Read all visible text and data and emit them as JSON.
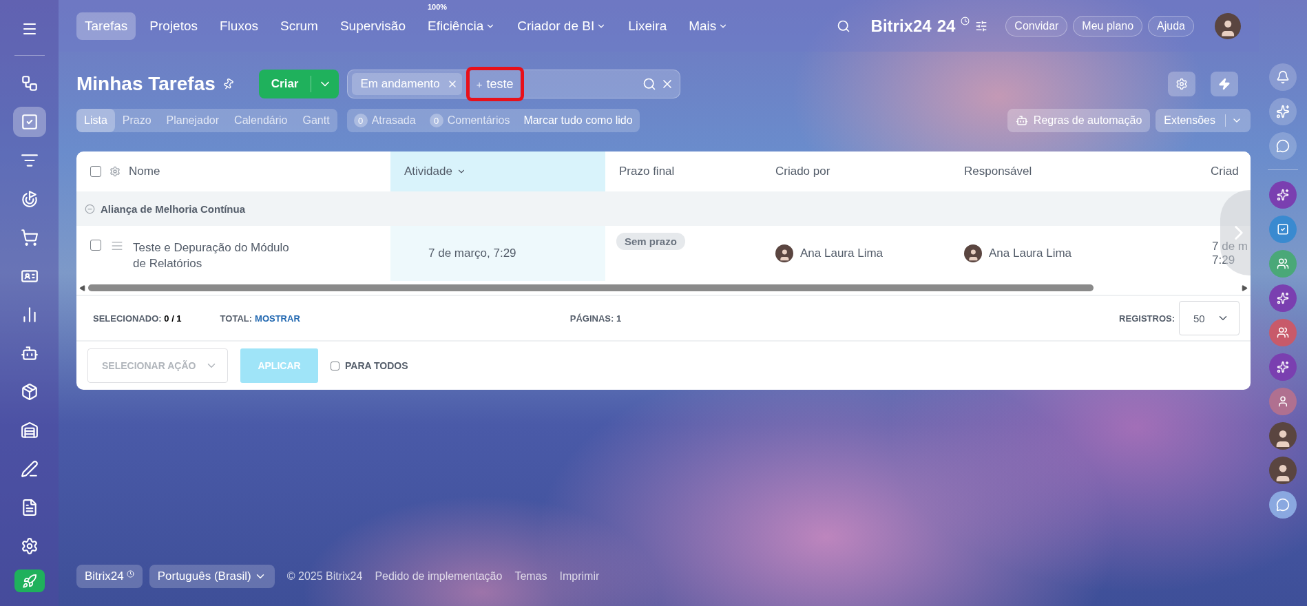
{
  "sidebar": {
    "items": [
      {
        "selected": false
      },
      {
        "selected": true
      },
      {
        "selected": false
      },
      {
        "selected": false
      },
      {
        "selected": false
      },
      {
        "selected": false
      },
      {
        "selected": false
      },
      {
        "selected": false
      },
      {
        "selected": false
      },
      {
        "selected": false
      },
      {
        "selected": false
      },
      {
        "selected": false
      }
    ]
  },
  "top_nav": {
    "items": [
      {
        "label": "Tarefas",
        "selected": true,
        "has_caret": false
      },
      {
        "label": "Projetos",
        "selected": false,
        "has_caret": false
      },
      {
        "label": "Fluxos",
        "selected": false,
        "has_caret": false
      },
      {
        "label": "Scrum",
        "selected": false,
        "has_caret": false
      },
      {
        "label": "Supervisão",
        "selected": false,
        "has_caret": false
      },
      {
        "label": "Eficiência",
        "selected": false,
        "has_caret": true,
        "badge": "100%"
      },
      {
        "label": "Criador de BI",
        "selected": false,
        "has_caret": true
      },
      {
        "label": "Lixeira",
        "selected": false,
        "has_caret": false
      },
      {
        "label": "Mais",
        "selected": false,
        "has_caret": true
      }
    ],
    "logo": "Bitrix24",
    "logo_number": "24",
    "buttons": [
      "Convidar",
      "Meu plano",
      "Ajuda"
    ]
  },
  "page": {
    "title": "Minhas Tarefas",
    "create_button": "Criar",
    "filter": {
      "tags": [
        {
          "label": "Em andamento"
        }
      ],
      "prefix": "+",
      "value": "teste",
      "highlighted": true
    },
    "view_tabs": [
      {
        "label": "Lista",
        "selected": true
      },
      {
        "label": "Prazo",
        "selected": false
      },
      {
        "label": "Planejador",
        "selected": false
      },
      {
        "label": "Calendário",
        "selected": false
      },
      {
        "label": "Gantt",
        "selected": false
      }
    ],
    "counters": [
      {
        "count": "0",
        "label": "Atrasada"
      },
      {
        "count": "0",
        "label": "Comentários"
      }
    ],
    "mark_all": "Marcar tudo como lido",
    "automation_button": "Regras de automação",
    "extensions_button": "Extensões"
  },
  "table": {
    "columns": [
      {
        "label": "Nome",
        "sorted": false
      },
      {
        "label": "Atividade",
        "sorted": true
      },
      {
        "label": "Prazo final",
        "sorted": false
      },
      {
        "label": "Criado por",
        "sorted": false
      },
      {
        "label": "Responsável",
        "sorted": false
      },
      {
        "label": "Criad",
        "sorted": false
      }
    ],
    "select_all_checked": false,
    "groups": [
      {
        "title": "Aliança de Melhoria Contínua",
        "expanded": true,
        "rows": [
          {
            "checked": false,
            "name": "Teste e Depuração do Módulo de Relatórios",
            "activity": "7 de março, 7:29",
            "deadline": "Sem prazo",
            "created_by": "Ana Laura Lima",
            "responsible": "Ana Laura Lima",
            "created": [
              "7 de m",
              "7:29"
            ]
          }
        ]
      }
    ],
    "selected_label": "SELECIONADO:",
    "selected_value": "0 / 1",
    "total_label": "TOTAL:",
    "total_link": "MOSTRAR",
    "pages_label": "PÁGINAS:",
    "pages_value": "1",
    "records_label": "REGISTROS:",
    "records_value": "50",
    "action_placeholder": "SELECIONAR AÇÃO",
    "apply_button": "APLICAR",
    "apply_disabled": true,
    "for_all": {
      "label": "PARA TODOS",
      "checked": false
    }
  },
  "footer": {
    "brand": "Bitrix24",
    "language": "Português (Brasil)",
    "copyright": "© 2025 Bitrix24",
    "links": [
      "Pedido de implementação",
      "Temas",
      "Imprimir"
    ]
  }
}
